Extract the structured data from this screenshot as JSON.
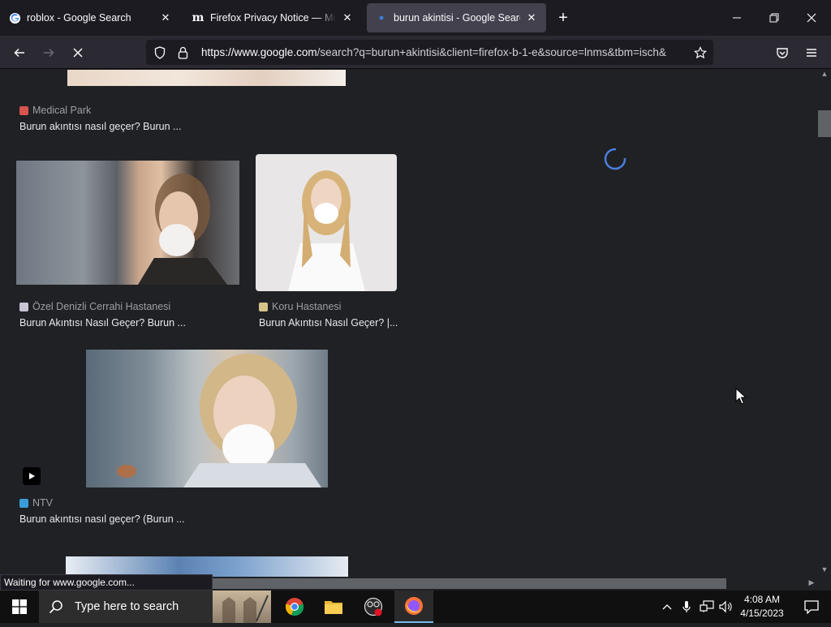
{
  "browser": {
    "tabs": [
      {
        "title": "roblox - Google Search",
        "icon": "google-g-icon",
        "active": false
      },
      {
        "title": "Firefox Privacy Notice — Mozill",
        "icon": "mozilla-m-icon",
        "active": false
      },
      {
        "title": "burun akintisi - Google Search",
        "icon": "loading-dot-icon",
        "active": true
      }
    ],
    "url_domain": "https://www.google.com",
    "url_path": "/search?q=burun+akintisi&client=firefox-b-1-e&source=lnms&tbm=isch&",
    "status": "Waiting for www.google.com...",
    "accent": "#1c1b22"
  },
  "results": [
    {
      "source": "Medical Park",
      "caption": "Burun akıntısı nasıl geçer? Burun ...",
      "icon_color": "#d9534f"
    },
    {
      "source": "Özel Denizli Cerrahi Hastanesi",
      "caption": "Burun Akıntısı Nasıl Geçer? Burun ...",
      "icon_color": "#c9c4d6"
    },
    {
      "source": "Koru Hastanesi",
      "caption": "Burun Akıntısı Nasıl Geçer? |...",
      "icon_color": "#d6c38a"
    },
    {
      "source": "NTV",
      "caption": "Burun akıntısı nasıl geçer? (Burun ...",
      "icon_color": "#3a9bd9"
    }
  ],
  "taskbar": {
    "search_placeholder": "Type here to search",
    "time": "4:08 AM",
    "date": "4/15/2023"
  }
}
